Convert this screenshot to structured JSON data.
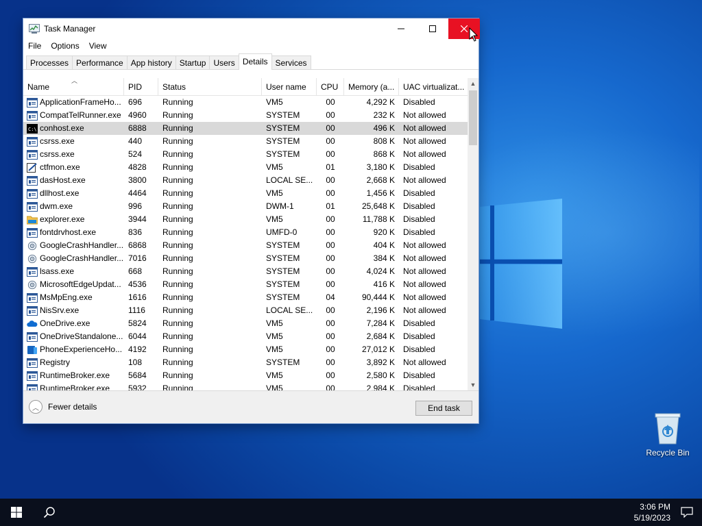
{
  "window": {
    "title": "Task Manager",
    "controls": {
      "minimize": "—",
      "maximize": "☐",
      "close": "✕"
    }
  },
  "menu": [
    "File",
    "Options",
    "View"
  ],
  "tabs": [
    "Processes",
    "Performance",
    "App history",
    "Startup",
    "Users",
    "Details",
    "Services"
  ],
  "active_tab": "Details",
  "columns": [
    "Name",
    "PID",
    "Status",
    "User name",
    "CPU",
    "Memory (a...",
    "UAC virtualizat..."
  ],
  "rows": [
    {
      "icon": "app-window-icon",
      "name": "ApplicationFrameHo...",
      "pid": "696",
      "status": "Running",
      "user": "VM5",
      "cpu": "00",
      "mem": "4,292 K",
      "uac": "Disabled"
    },
    {
      "icon": "app-window-icon",
      "name": "CompatTelRunner.exe",
      "pid": "4960",
      "status": "Running",
      "user": "SYSTEM",
      "cpu": "00",
      "mem": "232 K",
      "uac": "Not allowed"
    },
    {
      "icon": "console-icon",
      "name": "conhost.exe",
      "pid": "6888",
      "status": "Running",
      "user": "SYSTEM",
      "cpu": "00",
      "mem": "496 K",
      "uac": "Not allowed",
      "selected": true
    },
    {
      "icon": "app-window-icon",
      "name": "csrss.exe",
      "pid": "440",
      "status": "Running",
      "user": "SYSTEM",
      "cpu": "00",
      "mem": "808 K",
      "uac": "Not allowed"
    },
    {
      "icon": "app-window-icon",
      "name": "csrss.exe",
      "pid": "524",
      "status": "Running",
      "user": "SYSTEM",
      "cpu": "00",
      "mem": "868 K",
      "uac": "Not allowed"
    },
    {
      "icon": "pen-icon",
      "name": "ctfmon.exe",
      "pid": "4828",
      "status": "Running",
      "user": "VM5",
      "cpu": "01",
      "mem": "3,180 K",
      "uac": "Disabled"
    },
    {
      "icon": "app-window-icon",
      "name": "dasHost.exe",
      "pid": "3800",
      "status": "Running",
      "user": "LOCAL SE...",
      "cpu": "00",
      "mem": "2,668 K",
      "uac": "Not allowed"
    },
    {
      "icon": "app-window-icon",
      "name": "dllhost.exe",
      "pid": "4464",
      "status": "Running",
      "user": "VM5",
      "cpu": "00",
      "mem": "1,456 K",
      "uac": "Disabled"
    },
    {
      "icon": "app-window-icon",
      "name": "dwm.exe",
      "pid": "996",
      "status": "Running",
      "user": "DWM-1",
      "cpu": "01",
      "mem": "25,648 K",
      "uac": "Disabled"
    },
    {
      "icon": "folder-icon",
      "name": "explorer.exe",
      "pid": "3944",
      "status": "Running",
      "user": "VM5",
      "cpu": "00",
      "mem": "11,788 K",
      "uac": "Disabled"
    },
    {
      "icon": "app-window-icon",
      "name": "fontdrvhost.exe",
      "pid": "836",
      "status": "Running",
      "user": "UMFD-0",
      "cpu": "00",
      "mem": "920 K",
      "uac": "Disabled"
    },
    {
      "icon": "update-icon",
      "name": "GoogleCrashHandler...",
      "pid": "6868",
      "status": "Running",
      "user": "SYSTEM",
      "cpu": "00",
      "mem": "404 K",
      "uac": "Not allowed"
    },
    {
      "icon": "update-icon",
      "name": "GoogleCrashHandler...",
      "pid": "7016",
      "status": "Running",
      "user": "SYSTEM",
      "cpu": "00",
      "mem": "384 K",
      "uac": "Not allowed"
    },
    {
      "icon": "app-window-icon",
      "name": "lsass.exe",
      "pid": "668",
      "status": "Running",
      "user": "SYSTEM",
      "cpu": "00",
      "mem": "4,024 K",
      "uac": "Not allowed"
    },
    {
      "icon": "update-icon",
      "name": "MicrosoftEdgeUpdat...",
      "pid": "4536",
      "status": "Running",
      "user": "SYSTEM",
      "cpu": "00",
      "mem": "416 K",
      "uac": "Not allowed"
    },
    {
      "icon": "app-window-icon",
      "name": "MsMpEng.exe",
      "pid": "1616",
      "status": "Running",
      "user": "SYSTEM",
      "cpu": "04",
      "mem": "90,444 K",
      "uac": "Not allowed"
    },
    {
      "icon": "app-window-icon",
      "name": "NisSrv.exe",
      "pid": "1116",
      "status": "Running",
      "user": "LOCAL SE...",
      "cpu": "00",
      "mem": "2,196 K",
      "uac": "Not allowed"
    },
    {
      "icon": "cloud-icon",
      "name": "OneDrive.exe",
      "pid": "5824",
      "status": "Running",
      "user": "VM5",
      "cpu": "00",
      "mem": "7,284 K",
      "uac": "Disabled"
    },
    {
      "icon": "app-window-icon",
      "name": "OneDriveStandalone...",
      "pid": "6044",
      "status": "Running",
      "user": "VM5",
      "cpu": "00",
      "mem": "2,684 K",
      "uac": "Disabled"
    },
    {
      "icon": "phone-icon",
      "name": "PhoneExperienceHo...",
      "pid": "4192",
      "status": "Running",
      "user": "VM5",
      "cpu": "00",
      "mem": "27,012 K",
      "uac": "Disabled"
    },
    {
      "icon": "app-window-icon",
      "name": "Registry",
      "pid": "108",
      "status": "Running",
      "user": "SYSTEM",
      "cpu": "00",
      "mem": "3,892 K",
      "uac": "Not allowed"
    },
    {
      "icon": "app-window-icon",
      "name": "RuntimeBroker.exe",
      "pid": "5684",
      "status": "Running",
      "user": "VM5",
      "cpu": "00",
      "mem": "2,580 K",
      "uac": "Disabled"
    },
    {
      "icon": "app-window-icon",
      "name": "RuntimeBroker.exe",
      "pid": "5932",
      "status": "Running",
      "user": "VM5",
      "cpu": "00",
      "mem": "2,984 K",
      "uac": "Disabled"
    }
  ],
  "footer": {
    "fewer_details": "Fewer details",
    "end_task": "End task"
  },
  "desktop": {
    "recycle_bin": "Recycle Bin"
  },
  "taskbar": {
    "time": "3:06 PM",
    "date": "5/19/2023"
  },
  "colors": {
    "close_red": "#e81123",
    "selected_row": "#d9d9d9",
    "taskbar": "#0a0f1c"
  }
}
